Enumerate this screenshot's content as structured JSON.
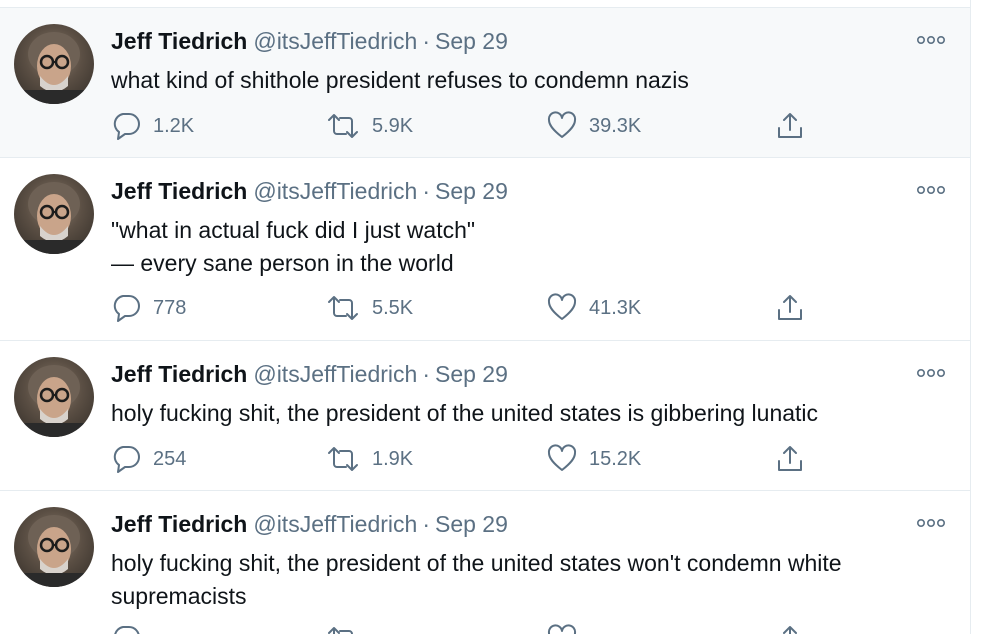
{
  "tweets": [
    {
      "name": "Jeff Tiedrich",
      "handle": "@itsJeffTiedrich",
      "separator": "·",
      "date": "Sep 29",
      "lines": [
        "what kind of shithole president refuses to condemn nazis"
      ],
      "replies": "1.2K",
      "retweets": "5.9K",
      "likes": "39.3K"
    },
    {
      "name": "Jeff Tiedrich",
      "handle": "@itsJeffTiedrich",
      "separator": "·",
      "date": "Sep 29",
      "lines": [
        "\"what in actual fuck did I just watch\"",
        "— every sane person in the world"
      ],
      "replies": "778",
      "retweets": "5.5K",
      "likes": "41.3K"
    },
    {
      "name": "Jeff Tiedrich",
      "handle": "@itsJeffTiedrich",
      "separator": "·",
      "date": "Sep 29",
      "lines": [
        "holy fucking shit, the president of the united states is gibbering lunatic"
      ],
      "replies": "254",
      "retweets": "1.9K",
      "likes": "15.2K"
    },
    {
      "name": "Jeff Tiedrich",
      "handle": "@itsJeffTiedrich",
      "separator": "·",
      "date": "Sep 29",
      "lines": [
        "holy fucking shit, the president of the united states won't condemn white",
        "supremacists"
      ],
      "replies": "",
      "retweets": "",
      "likes": ""
    }
  ],
  "colors": {
    "text": "#0f1419",
    "secondary": "#5b7083",
    "border": "#e6ecf0",
    "hover_background": "#f7f9fa"
  },
  "icons": {
    "reply": "reply-bubble-icon",
    "retweet": "retweet-arrows-icon",
    "like": "heart-icon",
    "share": "share-upload-icon",
    "more": "more-options-icon"
  }
}
